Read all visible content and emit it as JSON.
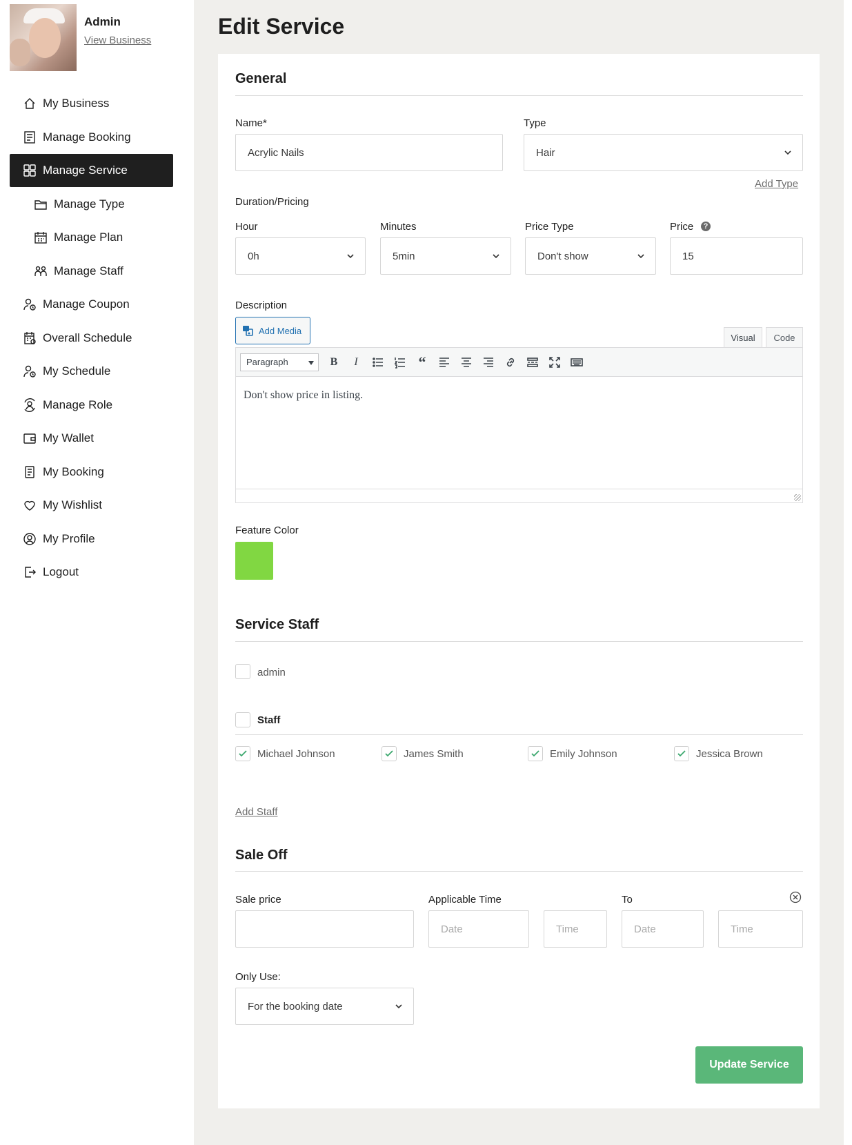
{
  "profile": {
    "name": "Admin",
    "view_business": "View Business"
  },
  "nav": [
    {
      "label": "My Business",
      "icon": "home-icon",
      "active": false,
      "sub": false
    },
    {
      "label": "Manage Booking",
      "icon": "booking-list-icon",
      "active": false,
      "sub": false
    },
    {
      "label": "Manage Service",
      "icon": "grid-icon",
      "active": true,
      "sub": false
    },
    {
      "label": "Manage Type",
      "icon": "folder-icon",
      "active": false,
      "sub": true
    },
    {
      "label": "Manage Plan",
      "icon": "calendar-plan-icon",
      "active": false,
      "sub": true
    },
    {
      "label": "Manage Staff",
      "icon": "staff-group-icon",
      "active": false,
      "sub": true
    },
    {
      "label": "Manage Coupon",
      "icon": "user-clock-icon",
      "active": false,
      "sub": false
    },
    {
      "label": "Overall Schedule",
      "icon": "schedule-calendar-icon",
      "active": false,
      "sub": false
    },
    {
      "label": "My Schedule",
      "icon": "user-clock-icon",
      "active": false,
      "sub": false
    },
    {
      "label": "Manage Role",
      "icon": "user-cycle-icon",
      "active": false,
      "sub": false
    },
    {
      "label": "My Wallet",
      "icon": "wallet-icon",
      "active": false,
      "sub": false
    },
    {
      "label": "My Booking",
      "icon": "document-icon",
      "active": false,
      "sub": false
    },
    {
      "label": "My Wishlist",
      "icon": "heart-icon",
      "active": false,
      "sub": false
    },
    {
      "label": "My Profile",
      "icon": "user-circle-icon",
      "active": false,
      "sub": false
    },
    {
      "label": "Logout",
      "icon": "logout-icon",
      "active": false,
      "sub": false
    }
  ],
  "page_title": "Edit Service",
  "general": {
    "title": "General",
    "name_label": "Name*",
    "name_value": "Acrylic Nails",
    "type_label": "Type",
    "type_value": "Hair",
    "add_type": "Add Type",
    "duration_label": "Duration/Pricing",
    "hour_label": "Hour",
    "hour_value": "0h",
    "minutes_label": "Minutes",
    "minutes_value": "5min",
    "price_type_label": "Price Type",
    "price_type_value": "Don't show",
    "price_label": "Price",
    "price_value": "15",
    "description_label": "Description",
    "add_media": "Add Media",
    "tab_visual": "Visual",
    "tab_code": "Code",
    "format_select": "Paragraph",
    "description_text": "Don't show price in listing.",
    "feature_color_label": "Feature Color",
    "feature_color": "#81d742"
  },
  "staff": {
    "title": "Service Staff",
    "admin_label": "admin",
    "staff_label": "Staff",
    "members": [
      {
        "name": "Michael Johnson",
        "checked": true
      },
      {
        "name": "James Smith",
        "checked": true
      },
      {
        "name": "Emily Johnson",
        "checked": true
      },
      {
        "name": "Jessica Brown",
        "checked": true
      }
    ],
    "add_staff": "Add Staff"
  },
  "sale": {
    "title": "Sale Off",
    "sale_price_label": "Sale price",
    "sale_price_value": "",
    "applicable_label": "Applicable Time",
    "to_label": "To",
    "date_placeholder": "Date",
    "time_placeholder": "Time",
    "only_use_label": "Only Use:",
    "only_use_value": "For the booking date"
  },
  "update_button": "Update Service",
  "colors": {
    "active_nav": "#1f1f1f",
    "update_button": "#5ab779",
    "link_blue": "#2271b1",
    "check_green": "#3aa76d"
  }
}
